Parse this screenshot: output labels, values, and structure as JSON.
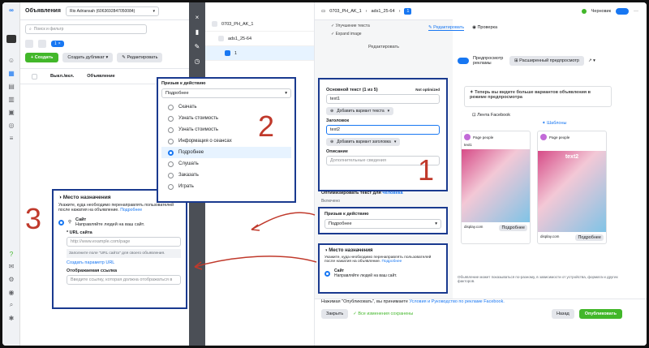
{
  "left": {
    "title": "Объявления",
    "account": "Rio Adriansah (6063692847050084)",
    "search_placeholder": "Поиск и фильтр",
    "badge_count": "1",
    "create_label": "Создать",
    "duplicate_label": "Создать дубликат",
    "edit_label": "Редактировать",
    "col_onoff": "Выкл./вкл.",
    "col_ad": "Объявление"
  },
  "tree": {
    "campaign": "0703_PH_AK_1",
    "adset": "ads1_25-64",
    "ad": "1"
  },
  "editor": {
    "crumb_campaign": "0703_PH_AK_1",
    "crumb_adset": "ads1_25-64",
    "crumb_ad": "1",
    "tab_edit": "Редактировать",
    "tab_review": "Проверка",
    "status": "Черновик",
    "opt1": "Улучшение текста",
    "opt2": "Expand image",
    "section": "Редактировать",
    "primary_label": "Основной текст (1 из 5)",
    "not_optimized": "Not optimized",
    "primary_value": "text1",
    "add_text_variant": "Добавить вариант текста",
    "headline_label": "Заголовок",
    "headline_value": "text2",
    "add_headline_variant": "Добавить вариант заголовка",
    "description_label": "Описание",
    "description_placeholder": "Дополнительные сведения",
    "optimize_text": "Оптимизировать текст для",
    "optimize_link": "человека",
    "optimize_state": "Включено"
  },
  "cta": {
    "label": "Призыв к действию",
    "value": "Подробнее"
  },
  "destination": {
    "title": "Место назначения",
    "desc": "Укажите, куда необходимо перенаправлять пользователей после нажатия на объявление.",
    "link": "Подробнее",
    "site_label": "Сайт",
    "site_desc": "Направляйте людей на ваш сайт.",
    "url_label": "* URL сайта",
    "url_placeholder": "http://www.example.com/page",
    "url_hint": "Заполните поле \"URL сайта\" для своего объявления.",
    "create_param": "Создать параметр URL",
    "display_link_label": "Отображаемая ссылка",
    "display_link_placeholder": "Введите ссылку, которая должна отображаться в"
  },
  "dropdown": {
    "label": "Призыв к действию",
    "selected": "Подробнее",
    "options": [
      "Скачать",
      "Узнать стоимость",
      "Узнать стоимость",
      "Информация о сеансах",
      "Подробнее",
      "Слушать",
      "Заказать",
      "Играть"
    ]
  },
  "preview": {
    "toggle_label": "Предпросмотр рекламы",
    "advanced_label": "Расширенный предпросмотр",
    "notice": "Теперь вы видите больше вариантов объявления в режиме предпросмотра",
    "feed_label": "Лента Facebook",
    "templates_label": "Шаблоны",
    "page_name": "Page people",
    "sponsored": "Реклама",
    "body_text": "text1",
    "image_title": "text2",
    "domain": "display.com",
    "cta_button": "Подробнее",
    "headline": "text2",
    "footnote": "Объявление может показываться по-разному, в зависимости от устройства, формата и других факторов."
  },
  "footer": {
    "terms_prefix": "Нажимая \"Опубликовать\", вы принимаете",
    "terms_link": "Условия и Руководство по рекламе Facebook.",
    "close": "Закрыть",
    "saved": "Все изменения сохранены",
    "back": "Назад",
    "publish": "Опубликовать"
  },
  "annotations": {
    "n1": "1",
    "n2": "2",
    "n3": "3"
  }
}
